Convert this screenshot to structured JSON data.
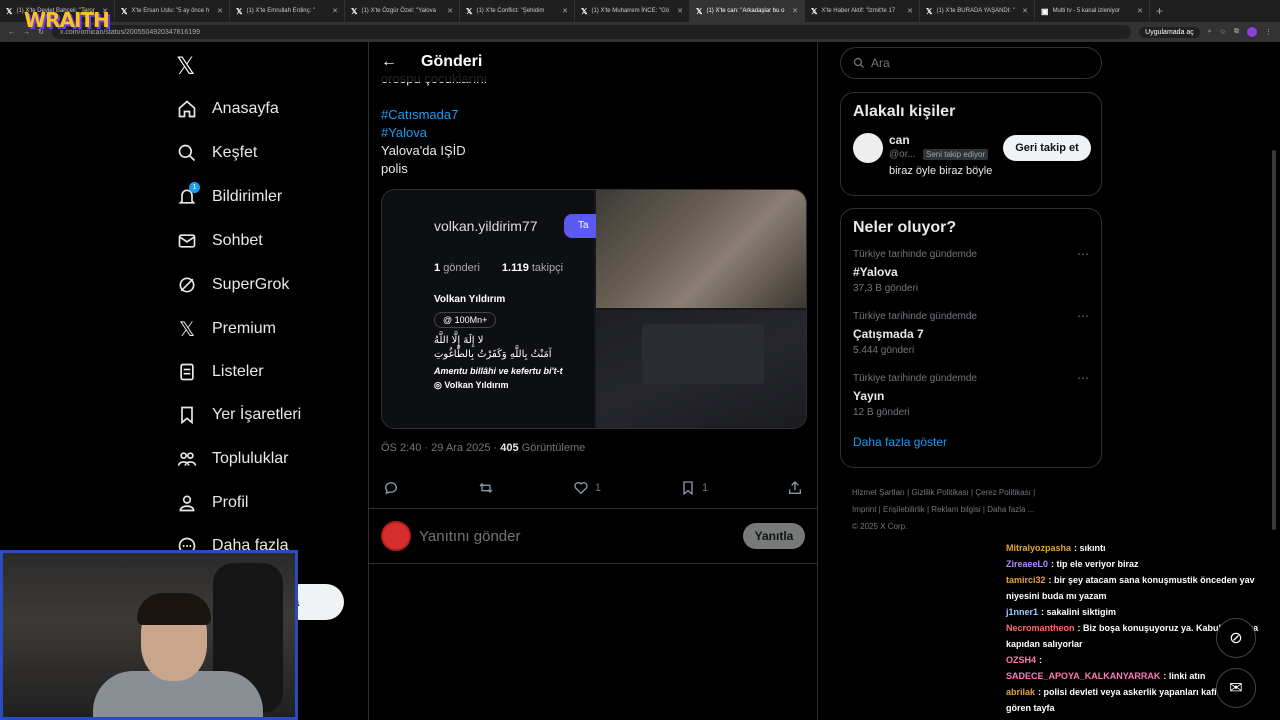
{
  "overlay_logo": "WRAITH",
  "browser": {
    "tabs": [
      {
        "label": "(1) X'te Devlet Bahçeli: \"Teror"
      },
      {
        "label": "X'te Ersan Uslu: \"5 ay önce h"
      },
      {
        "label": "(1) X'te Emrullah Erdinç: \""
      },
      {
        "label": "(1) X'te Özgür Özel: \"Yalova"
      },
      {
        "label": "(1) X'te Conflict: \"Şehidim"
      },
      {
        "label": "(1) X'te Muharrem İNCE: \"Gö"
      },
      {
        "label": "(1) X'te can: \"Arkadaşlar bu o"
      },
      {
        "label": "X'te Haber Aktif: \"İzmit'te 17"
      },
      {
        "label": "(1) X'te BURADA YAŞANDI: \""
      },
      {
        "label": "Multi tv - 5 kanal izleniyor"
      }
    ],
    "url": "x.com/ornican/status/2005504920347816199",
    "app_button": "Uygulamada aç"
  },
  "sidebar": {
    "items": [
      {
        "label": "Anasayfa",
        "icon": "home-icon"
      },
      {
        "label": "Keşfet",
        "icon": "search-icon"
      },
      {
        "label": "Bildirimler",
        "icon": "bell-icon",
        "badge": "1"
      },
      {
        "label": "Sohbet",
        "icon": "mail-icon"
      },
      {
        "label": "SuperGrok",
        "icon": "grok-icon"
      },
      {
        "label": "Premium",
        "icon": "x-logo-icon"
      },
      {
        "label": "Listeler",
        "icon": "list-icon"
      },
      {
        "label": "Yer İşaretleri",
        "icon": "bookmark-icon"
      },
      {
        "label": "Topluluklar",
        "icon": "people-icon"
      },
      {
        "label": "Profil",
        "icon": "person-icon"
      },
      {
        "label": "Daha fazla",
        "icon": "more-icon"
      }
    ],
    "post_button_tail": "a"
  },
  "post": {
    "header_title": "Gönderi",
    "text_fragment": "orospu çocuklarını",
    "hashtag1": "#Catısmada7",
    "hashtag2": "#Yalova",
    "line1": "Yalova'da IŞİD",
    "line2": "polis",
    "media": {
      "username": "volkan.yildirim77",
      "follow_label": "Ta",
      "posts_count": "1",
      "posts_label": "gönderi",
      "followers_count": "1.119",
      "followers_label": "takipçi",
      "full_name": "Volkan Yıldırım",
      "threads_badge": "100Mn+",
      "arabic1": "لا إِلَهَ إِلَّا اللَّهُ",
      "arabic2": "آمَنْتُ بِاللَّهِ وَكَفَرْتُ بِالطَّاغُوتِ",
      "bio_latin": "Amentu billâhi ve kefertu bi't-t",
      "bio_name": "Volkan Yıldırım"
    },
    "time": "ÖS 2:40 · 29 Ara 2025 · ",
    "views_count": "405",
    "views_label": "Görüntüleme",
    "likes": "1",
    "bookmarks": "1",
    "reply_placeholder": "Yanıtını gönder",
    "reply_button": "Yanıtla"
  },
  "right": {
    "search_placeholder": "Ara",
    "related_title": "Alakalı kişiler",
    "person": {
      "name": "can",
      "handle": "@or...",
      "follows_you": "Seni takip ediyor",
      "bio": "biraz öyle biraz böyle",
      "follow_back": "Geri takip et"
    },
    "trends_title": "Neler oluyor?",
    "trends": [
      {
        "context": "Türkiye tarihinde gündemde",
        "title": "#Yalova",
        "count": "37,3 B gönderi"
      },
      {
        "context": "Türkiye tarihinde gündemde",
        "title": "Çatışmada 7",
        "count": "5.444 gönderi"
      },
      {
        "context": "Türkiye tarihinde gündemde",
        "title": "Yayın",
        "count": "12 B gönderi"
      }
    ],
    "show_more": "Daha fazla göster",
    "footer": {
      "l1": "Hizmet Şartları",
      "l2": "Gizlilik Politikası",
      "l3": "Çerez Politikası",
      "l4": "Imprint",
      "l5": "Erişilebilirlik",
      "l6": "Reklam bilgisi",
      "l7": "Daha fazla ...",
      "copy": "© 2025 X Corp."
    }
  },
  "chat": [
    {
      "user": "Mitralyozpasha",
      "color": "#e6a23c",
      "msg": ": sıkıntı"
    },
    {
      "user": "ZireaeeL0",
      "color": "#b48cff",
      "msg": ": tip ele veriyor biraz"
    },
    {
      "user": "tamirci32",
      "color": "#e6a23c",
      "msg": ": bir şey atacam sana konuşmustik önceden yav niyesini buda mı yazam"
    },
    {
      "user": "j1nner1",
      "color": "#9ad0ff",
      "msg": ": sakalini siktigim"
    },
    {
      "user": "Necromantheon",
      "color": "#ff6b6b",
      "msg": ": Biz boşa konuşuyoruz ya. Kabukları arka kapıdan salıyorlar"
    },
    {
      "user": "OZSH4",
      "color": "#ff7ab6",
      "msg": ":"
    },
    {
      "user": "SADECE_APOYA_KALKANYARRAK",
      "color": "#ff7ab6",
      "msg": ": linki atın"
    },
    {
      "user": "abrilak",
      "color": "#e6a23c",
      "msg": ": polisi devleti veya askerlik yapanları kafir olarak gören tayfa"
    }
  ]
}
